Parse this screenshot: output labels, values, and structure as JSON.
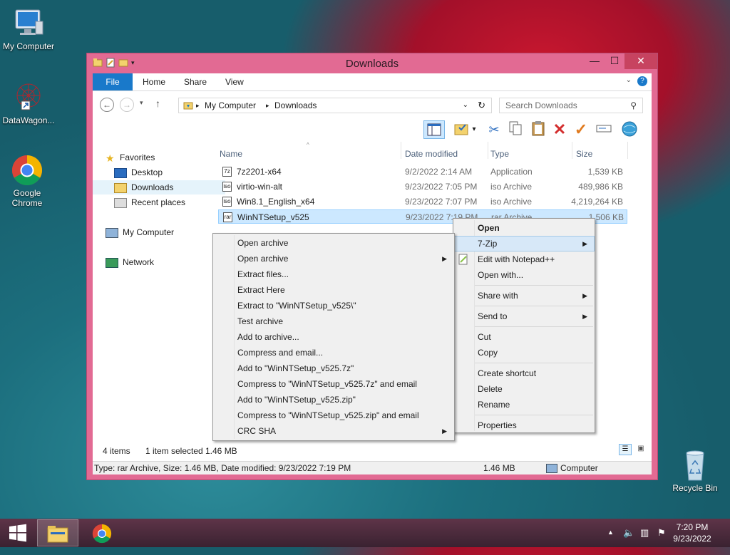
{
  "desktop": {
    "icons": [
      {
        "label": "My Computer"
      },
      {
        "label": "DataWagon..."
      },
      {
        "label": "Google Chrome"
      },
      {
        "label": "Recycle Bin"
      }
    ]
  },
  "window": {
    "title": "Downloads",
    "tabs": {
      "file": "File",
      "home": "Home",
      "share": "Share",
      "view": "View"
    },
    "address": {
      "root": "My Computer",
      "current": "Downloads"
    },
    "search": {
      "placeholder": "Search Downloads"
    },
    "columns": {
      "name": "Name",
      "date": "Date modified",
      "type": "Type",
      "size": "Size"
    },
    "nav": {
      "favorites": "Favorites",
      "desktop": "Desktop",
      "downloads": "Downloads",
      "recent": "Recent places",
      "computer": "My Computer",
      "network": "Network"
    },
    "files": [
      {
        "name": "7z2201-x64",
        "date": "9/2/2022 2:14 AM",
        "type": "Application",
        "size": "1,539 KB",
        "icon": "7z"
      },
      {
        "name": "virtio-win-alt",
        "date": "9/23/2022 7:05 PM",
        "type": "iso Archive",
        "size": "489,986 KB",
        "icon": "iso"
      },
      {
        "name": "Win8.1_English_x64",
        "date": "9/23/2022 7:07 PM",
        "type": "iso Archive",
        "size": "4,219,264 KB",
        "icon": "iso"
      },
      {
        "name": "WinNTSetup_v525",
        "date": "9/23/2022 7:19 PM",
        "type": "rar Archive",
        "size": "1,506 KB",
        "icon": "rar"
      }
    ],
    "status": {
      "count": "4 items",
      "selected": "1 item selected",
      "selected_size": "1.46 MB",
      "details": "Type: rar Archive, Size: 1.46 MB, Date modified: 9/23/2022 7:19 PM",
      "size": "1.46 MB",
      "location": "Computer"
    }
  },
  "context_menu": {
    "items": {
      "open": "Open",
      "zip": "7-Zip",
      "notepad": "Edit with Notepad++",
      "open_with": "Open with...",
      "share_with": "Share with",
      "send_to": "Send to",
      "cut": "Cut",
      "copy": "Copy",
      "create_shortcut": "Create shortcut",
      "delete": "Delete",
      "rename": "Rename",
      "properties": "Properties"
    }
  },
  "zip_menu": {
    "items": [
      "Open archive",
      "Open archive",
      "Extract files...",
      "Extract Here",
      "Extract to \"WinNTSetup_v525\\\"",
      "Test archive",
      "Add to archive...",
      "Compress and email...",
      "Add to \"WinNTSetup_v525.7z\"",
      "Compress to \"WinNTSetup_v525.7z\" and email",
      "Add to \"WinNTSetup_v525.zip\"",
      "Compress to \"WinNTSetup_v525.zip\" and email",
      "CRC SHA"
    ]
  },
  "taskbar": {
    "time": "7:20 PM",
    "date": "9/23/2022"
  }
}
